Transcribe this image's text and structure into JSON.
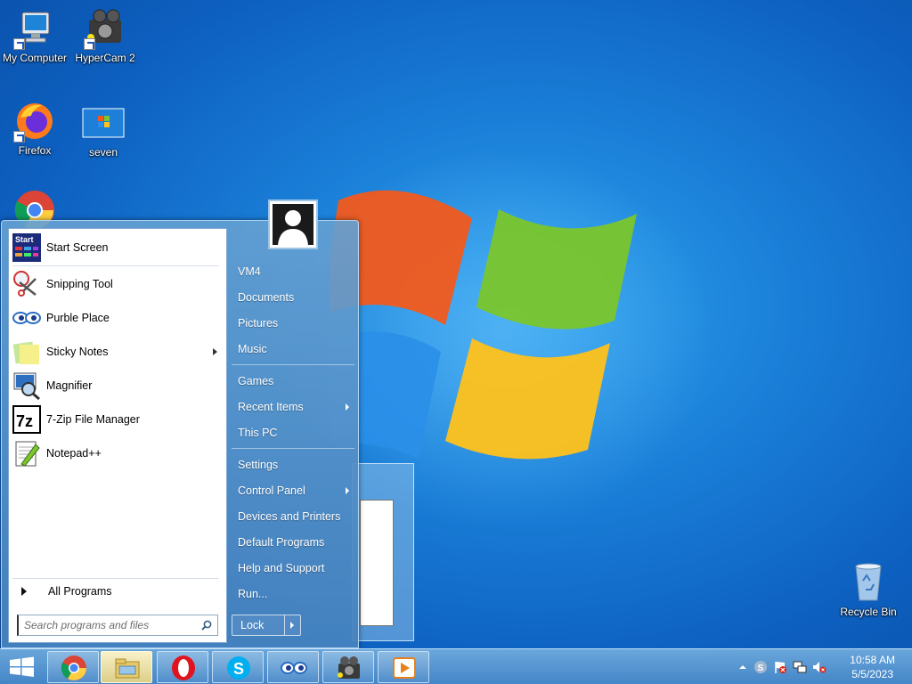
{
  "desktop": {
    "icons": [
      {
        "label": "My Computer"
      },
      {
        "label": "HyperCam 2"
      },
      {
        "label": "Firefox"
      },
      {
        "label": "seven"
      },
      {
        "label": "Recycle Bin"
      }
    ]
  },
  "start_menu": {
    "programs": [
      {
        "label": "Start Screen",
        "icon": "start-screen-icon"
      },
      {
        "label": "Snipping Tool",
        "icon": "scissors-icon"
      },
      {
        "label": "Purble Place",
        "icon": "eyes-icon"
      },
      {
        "label": "Sticky Notes",
        "icon": "sticky-notes-icon",
        "submenu": true
      },
      {
        "label": "Magnifier",
        "icon": "magnifier-icon"
      },
      {
        "label": "7-Zip File Manager",
        "icon": "7zip-icon"
      },
      {
        "label": "Notepad++",
        "icon": "notepad-plus-icon"
      }
    ],
    "start_icon_text": "Start",
    "zip_icon_text": "7z",
    "all_programs": "All Programs",
    "search_placeholder": "Search programs and files",
    "right_items": [
      {
        "label": "VM4"
      },
      {
        "label": "Documents"
      },
      {
        "label": "Pictures"
      },
      {
        "label": "Music"
      },
      {
        "label": "Games"
      },
      {
        "label": "Recent Items",
        "submenu": true
      },
      {
        "label": "This PC"
      },
      {
        "label": "Settings"
      },
      {
        "label": "Control Panel",
        "submenu": true
      },
      {
        "label": "Devices and Printers"
      },
      {
        "label": "Default Programs"
      },
      {
        "label": "Help and Support"
      },
      {
        "label": "Run..."
      }
    ],
    "lock_label": "Lock"
  },
  "taskbar": {
    "pinned": [
      "chrome-icon",
      "file-explorer-icon",
      "opera-icon",
      "skype-icon",
      "purble-place-icon",
      "hypercam-icon",
      "media-player-icon"
    ],
    "active": "file-explorer-icon",
    "tray_icons": [
      "show-hidden-icons-chevron",
      "skype-tray-icon",
      "action-center-flag-icon",
      "network-icon",
      "volume-muted-icon"
    ],
    "clock_time": "10:58 AM",
    "clock_date": "5/5/2023"
  },
  "colors": {
    "wallpaper": "#1a7fd8",
    "start_menu_glass": "#5f9dd2",
    "accent_white": "#ffffff"
  }
}
